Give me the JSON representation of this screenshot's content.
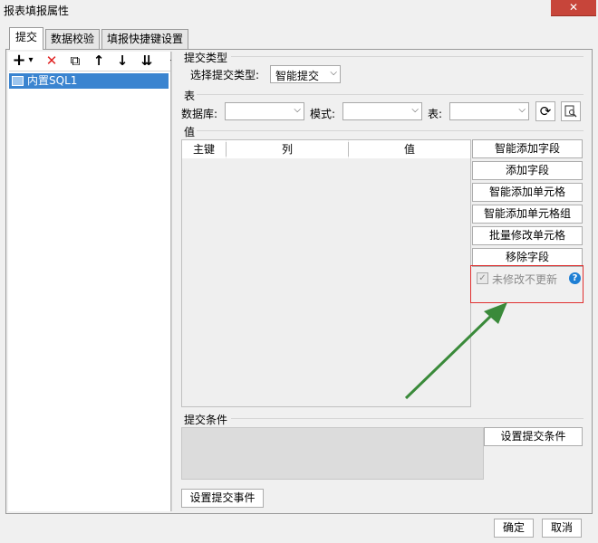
{
  "window": {
    "title": "报表填报属性",
    "close_glyph": "✕"
  },
  "tabs": [
    {
      "label": "提交"
    },
    {
      "label": "数据校验"
    },
    {
      "label": "填报快捷键设置"
    }
  ],
  "toolbar": {
    "add": "+",
    "add_dropdown": "▾",
    "delete": "✕",
    "copy": "⧉",
    "up": "↑",
    "down": "↓",
    "sort": "⇊",
    "collapse": "◂"
  },
  "tree": {
    "items": [
      {
        "label": "内置SQL1"
      }
    ]
  },
  "submit_type": {
    "section_title": "提交类型",
    "select_label": "选择提交类型:",
    "select_value": "智能提交"
  },
  "table_section": {
    "title": "表",
    "database_label": "数据库:",
    "database_value": "",
    "schema_label": "模式:",
    "schema_value": "",
    "table_label": "表:",
    "table_value": ""
  },
  "values": {
    "title": "值",
    "columns": [
      "主键",
      "列",
      "值"
    ],
    "buttons": [
      "智能添加字段",
      "添加字段",
      "智能添加单元格",
      "智能添加单元格组",
      "批量修改单元格",
      "移除字段"
    ],
    "checkbox_label": "未修改不更新",
    "checkbox_checked": true,
    "help_glyph": "?"
  },
  "submit_condition": {
    "title": "提交条件",
    "button": "设置提交条件"
  },
  "submit_event": {
    "button": "设置提交事件"
  },
  "dialog": {
    "ok": "确定",
    "cancel": "取消"
  }
}
